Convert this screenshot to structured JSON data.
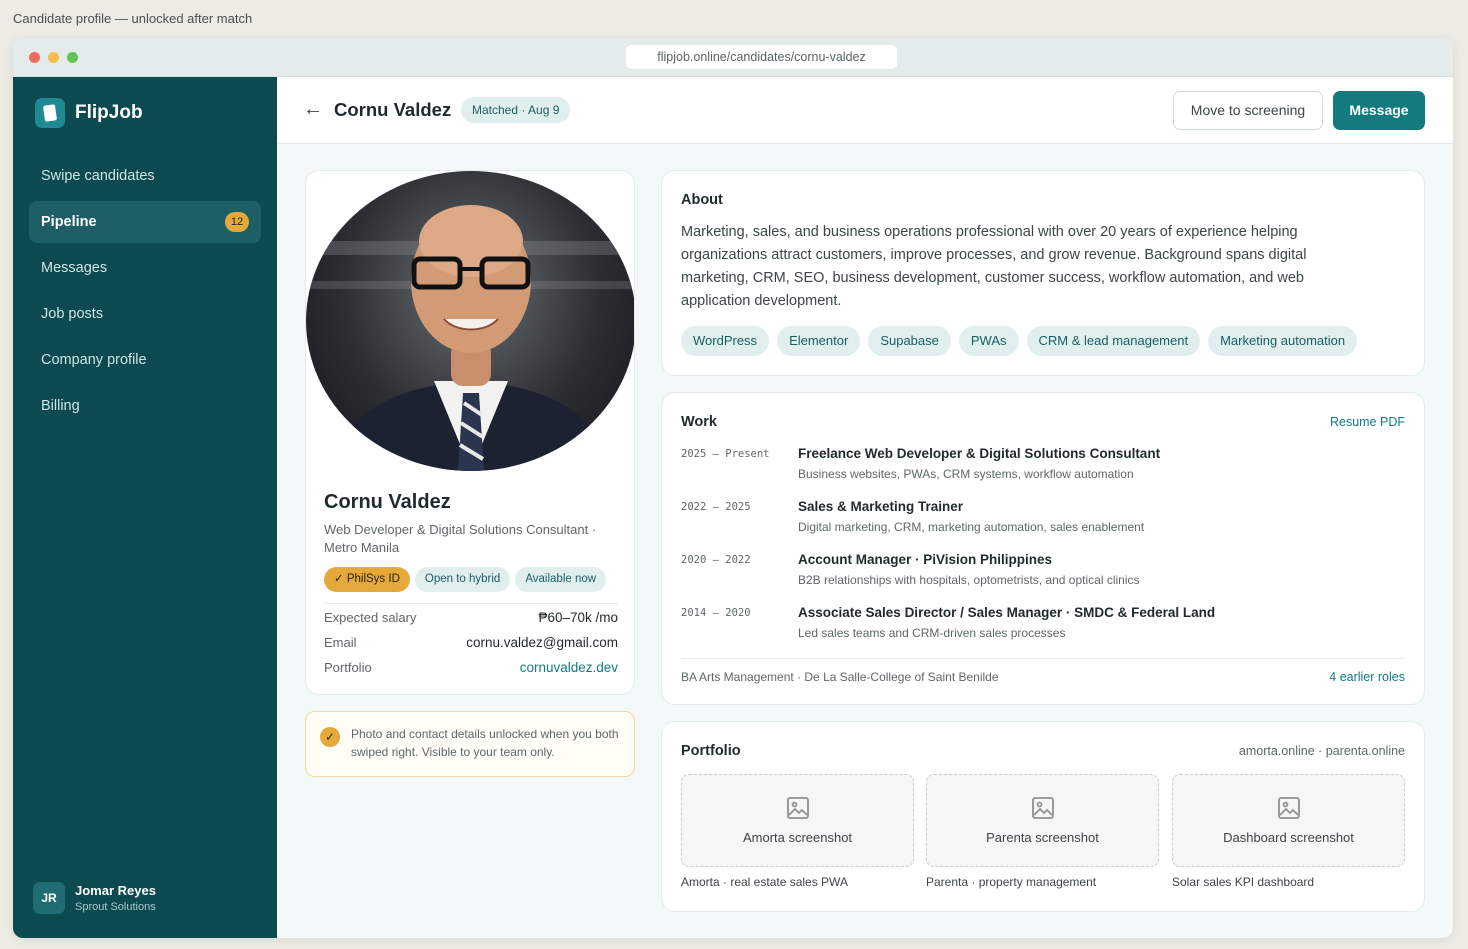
{
  "page_caption": "Candidate profile — unlocked after match",
  "browser": {
    "url": "flipjob.online/candidates/cornu-valdez"
  },
  "sidebar": {
    "brand": "FlipJob",
    "items": [
      {
        "label": "Swipe candidates"
      },
      {
        "label": "Pipeline",
        "badge": "12",
        "active": true
      },
      {
        "label": "Messages"
      },
      {
        "label": "Job posts"
      },
      {
        "label": "Company profile"
      },
      {
        "label": "Billing"
      }
    ],
    "user": {
      "initials": "JR",
      "name": "Jomar Reyes",
      "org": "Sprout Solutions"
    }
  },
  "header": {
    "back_icon": "←",
    "title": "Cornu Valdez",
    "status": "Matched · Aug 9",
    "move_button": "Move to screening",
    "message_button": "Message"
  },
  "profile": {
    "name": "Cornu Valdez",
    "role": "Web Developer & Digital Solutions Consultant · Metro Manila",
    "tags": [
      "✓ PhilSys ID",
      "Open to hybrid",
      "Available now"
    ],
    "salary_label": "Expected salary",
    "salary": "₱60–70k /mo",
    "email_label": "Email",
    "email": "cornu.valdez@gmail.com",
    "portfolio_label": "Portfolio",
    "portfolio": "cornuvaldez.dev"
  },
  "notice": {
    "icon": "✓",
    "text": "Photo and contact details unlocked when you both swiped right. Visible to your team only."
  },
  "about": {
    "title": "About",
    "text": "Marketing, sales, and business operations professional with over 20 years of experience helping organizations attract customers, improve processes, and grow revenue. Background spans digital marketing, CRM, SEO, business development, customer success, workflow automation, and web application development.",
    "skills": [
      "WordPress",
      "Elementor",
      "Supabase",
      "PWAs",
      "CRM & lead management",
      "Marketing automation"
    ]
  },
  "work": {
    "title": "Work",
    "resume_link": "Resume PDF",
    "items": [
      {
        "dates": "2025 – Present",
        "title": "Freelance Web Developer & Digital Solutions Consultant",
        "desc": "Business websites, PWAs, CRM systems, workflow automation"
      },
      {
        "dates": "2022 – 2025",
        "title": "Sales & Marketing Trainer",
        "desc": "Digital marketing, CRM, marketing automation, sales enablement"
      },
      {
        "dates": "2020 – 2022",
        "title": "Account Manager · PiVision Philippines",
        "desc": "B2B relationships with hospitals, optometrists, and optical clinics"
      },
      {
        "dates": "2014 – 2020",
        "title": "Associate Sales Director / Sales Manager · SMDC & Federal Land",
        "desc": "Led sales teams and CRM-driven sales processes"
      }
    ],
    "education": "BA Arts Management · De La Salle-College of Saint Benilde",
    "earlier_link": "4 earlier roles"
  },
  "portfolio": {
    "title": "Portfolio",
    "sites": "amorta.online · parenta.online",
    "items": [
      {
        "label": "Amorta screenshot",
        "caption": "Amorta · real estate sales PWA"
      },
      {
        "label": "Parenta screenshot",
        "caption": "Parenta · property management"
      },
      {
        "label": "Dashboard screenshot",
        "caption": "Solar sales KPI dashboard"
      }
    ]
  }
}
